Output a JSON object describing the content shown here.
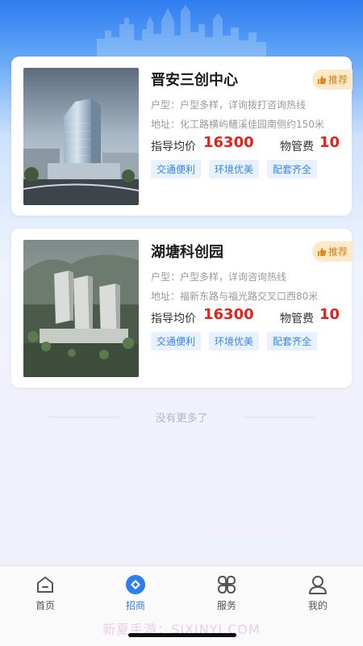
{
  "listings": [
    {
      "name": "晋安三创中心",
      "badge": "推荐",
      "unit_type": "户型：户型多样，详询拨打咨询热线",
      "address": "地址：化工路横屿鳝溪佳园南侧约150米",
      "price_label": "指导均价",
      "price": "16300",
      "fee_label": "物管费",
      "fee": "10",
      "tags": [
        "交通便利",
        "环境优美",
        "配套齐全"
      ]
    },
    {
      "name": "湖塘科创园",
      "badge": "推荐",
      "unit_type": "户型：户型多样，详询咨询热线",
      "address": "地址：福新东路与福光路交叉口西80米",
      "price_label": "指导均价",
      "price": "16300",
      "fee_label": "物管费",
      "fee": "10",
      "tags": [
        "交通便利",
        "环境优美",
        "配套齐全"
      ]
    }
  ],
  "end_text": "没有更多了",
  "tabbar": {
    "items": [
      {
        "label": "首页",
        "icon": "home-icon",
        "active": false
      },
      {
        "label": "招商",
        "icon": "invest-icon",
        "active": true
      },
      {
        "label": "服务",
        "icon": "grid-icon",
        "active": false
      },
      {
        "label": "我的",
        "icon": "user-icon",
        "active": false
      }
    ]
  },
  "watermark": "新夏手游：SIXINYI.COM",
  "colors": {
    "accent": "#2f7cf0",
    "price": "#e0231d",
    "badge_bg": "#fde8c8",
    "badge_text": "#d3801b",
    "tag_bg": "#e8f1fe",
    "tag_text": "#3a86e8"
  }
}
